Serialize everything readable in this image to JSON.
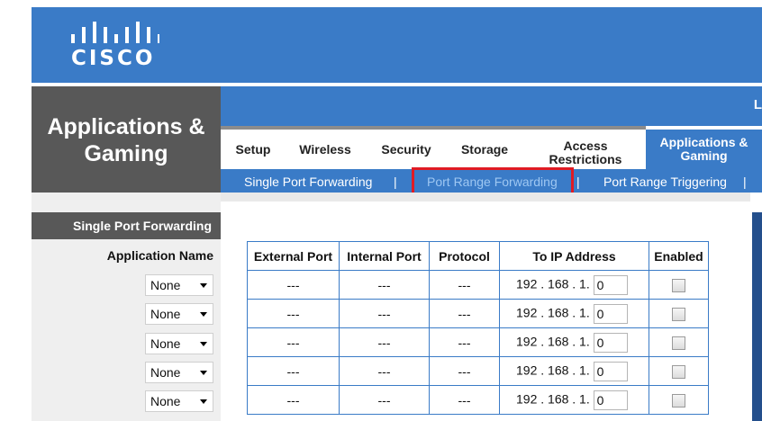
{
  "brand": {
    "name": "CISCO"
  },
  "section": {
    "title_line1": "Applications &",
    "title_line2": "Gaming"
  },
  "topband": {
    "text": "L"
  },
  "nav": {
    "tabs": [
      {
        "label": "Setup"
      },
      {
        "label": "Wireless"
      },
      {
        "label": "Security"
      },
      {
        "label": "Storage"
      },
      {
        "label": "Access Restrictions"
      },
      {
        "label": "Applications & Gaming"
      }
    ]
  },
  "subnav": {
    "items": [
      {
        "label": "Single Port Forwarding"
      },
      {
        "label": "Port Range Forwarding"
      },
      {
        "label": "Port Range Triggering"
      }
    ],
    "separator": "|"
  },
  "left": {
    "header": "Single Port Forwarding",
    "sub": "Application Name",
    "rows": [
      {
        "value": "None"
      },
      {
        "value": "None"
      },
      {
        "value": "None"
      },
      {
        "value": "None"
      },
      {
        "value": "None"
      }
    ]
  },
  "table": {
    "columns": [
      "External Port",
      "Internal Port",
      "Protocol",
      "To IP Address",
      "Enabled"
    ],
    "ip_prefix": "192 . 168 . 1.",
    "rows": [
      {
        "external": "---",
        "internal": "---",
        "protocol": "---",
        "ip_last": "0"
      },
      {
        "external": "---",
        "internal": "---",
        "protocol": "---",
        "ip_last": "0"
      },
      {
        "external": "---",
        "internal": "---",
        "protocol": "---",
        "ip_last": "0"
      },
      {
        "external": "---",
        "internal": "---",
        "protocol": "---",
        "ip_last": "0"
      },
      {
        "external": "---",
        "internal": "---",
        "protocol": "---",
        "ip_last": "0"
      }
    ]
  },
  "colors": {
    "brand_blue": "#3a7bc7",
    "dark_gray": "#585858",
    "highlight_red": "#e01b24"
  }
}
